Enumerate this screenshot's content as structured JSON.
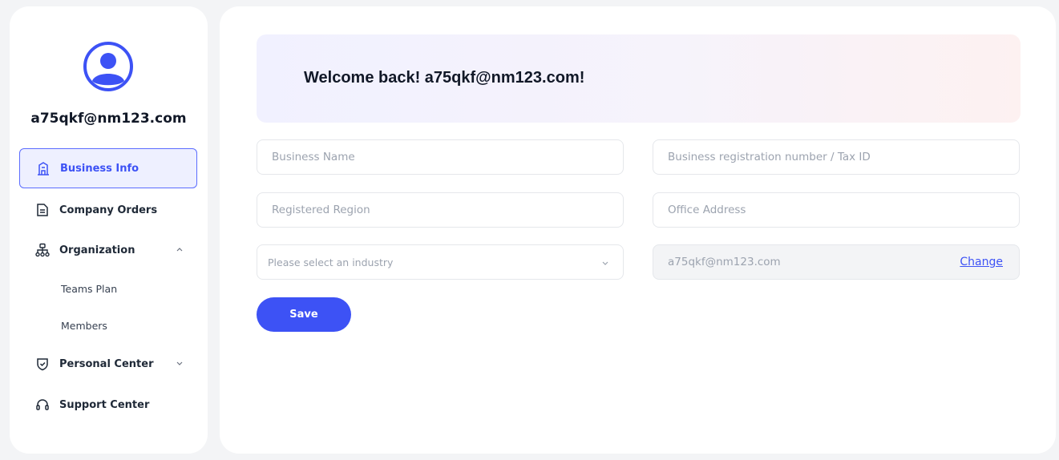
{
  "user": {
    "email": "a75qkf@nm123.com"
  },
  "sidebar": {
    "items": [
      {
        "label": "Business Info",
        "icon": "building-icon",
        "active": true
      },
      {
        "label": "Company Orders",
        "icon": "document-icon"
      },
      {
        "label": "Organization",
        "icon": "org-chart-icon",
        "expanded": true,
        "children": [
          {
            "label": "Teams Plan"
          },
          {
            "label": "Members"
          }
        ]
      },
      {
        "label": "Personal Center",
        "icon": "shield-check-icon",
        "expanded": false
      },
      {
        "label": "Support Center",
        "icon": "headset-icon"
      }
    ]
  },
  "main": {
    "welcome": "Welcome back! a75qkf@nm123.com!",
    "form": {
      "business_name_placeholder": "Business Name",
      "tax_id_placeholder": "Business registration number / Tax ID",
      "region_placeholder": "Registered Region",
      "office_placeholder": "Office Address",
      "industry_placeholder": "Please select an industry",
      "email_value": "a75qkf@nm123.com",
      "change_label": "Change",
      "save_label": "Save"
    }
  },
  "colors": {
    "accent": "#3d52f5",
    "active_bg": "#eef0ff"
  }
}
